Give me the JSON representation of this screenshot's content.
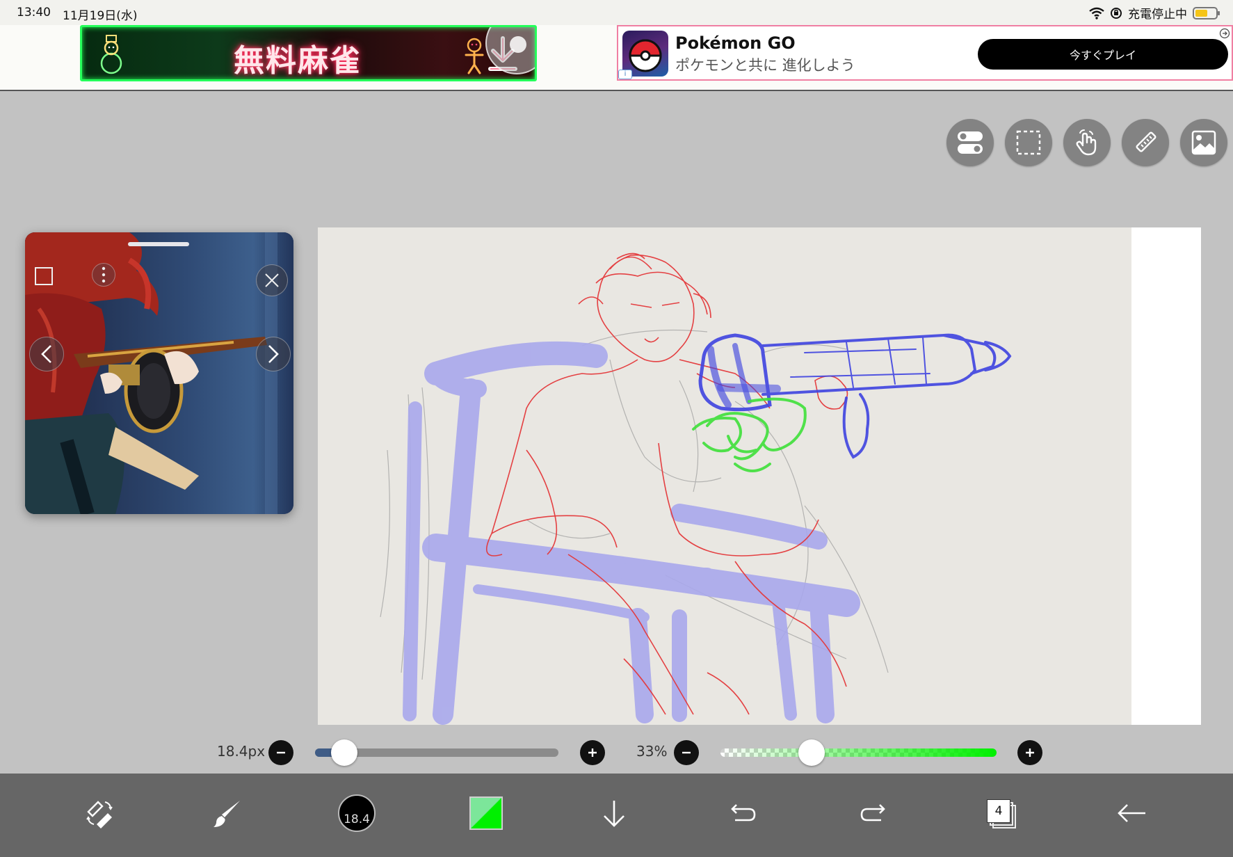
{
  "status_bar": {
    "time": "13:40",
    "date": "11月19日(水)",
    "charging_status": "充電停止中",
    "battery_color": "#f5c518"
  },
  "ads": {
    "mahjong": {
      "title": "無料麻雀",
      "border_color": "#24ff5a"
    },
    "pokemon": {
      "title": "Pokémon GO",
      "subtitle": "ポケモンと共に 進化しよう",
      "cta": "今すぐプレイ",
      "info_glyph": "i"
    }
  },
  "top_tools": [
    {
      "name": "toggle-icon"
    },
    {
      "name": "selection-icon"
    },
    {
      "name": "hand-icon"
    },
    {
      "name": "ruler-icon"
    },
    {
      "name": "image-icon"
    }
  ],
  "reference_panel": {
    "controls": [
      "frame-icon",
      "more-vertical-icon",
      "close-icon",
      "chevron-left-icon",
      "chevron-right-icon"
    ]
  },
  "brush": {
    "size_label": "18.4px",
    "size_value": 18.4,
    "size_fraction": 0.12,
    "opacity_label": "33%",
    "opacity_fraction": 0.33,
    "color": "#00f000"
  },
  "bottom_toolbar": {
    "brush_size_badge": "18.4",
    "layer_count": "4",
    "items": [
      "tool-switch-icon",
      "brush-icon",
      "brush-size",
      "color-swatch",
      "download-icon",
      "undo-icon",
      "redo-icon",
      "layers-icon",
      "back-icon"
    ]
  },
  "colors": {
    "background": "#c2c2c2",
    "toolbar": "#666666",
    "sketch_red": "#e4383a",
    "sketch_blue": "#3f44e0",
    "sketch_purple": "#a9a8ec",
    "sketch_green": "#3fe03a"
  }
}
